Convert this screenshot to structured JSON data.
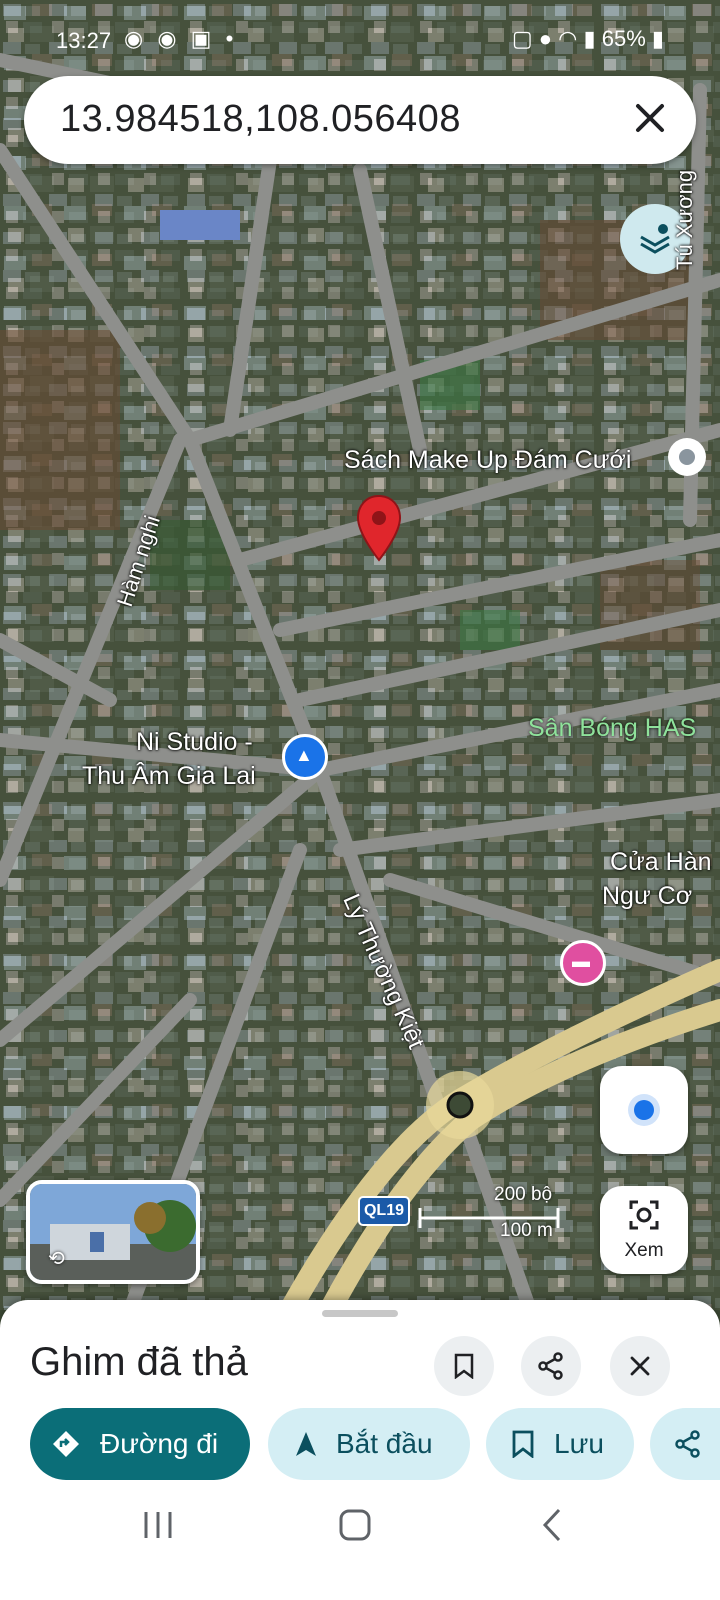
{
  "status_bar": {
    "time": "13:27",
    "notification_icons": [
      "messenger-icon",
      "messenger-icon",
      "shop-icon"
    ],
    "battery": "65%"
  },
  "search": {
    "query": "13.984518,108.056408"
  },
  "map": {
    "labels": {
      "place_1": "Sách Make Up Đám Cưới",
      "place_2_line1": "Ni Studio -",
      "place_2_line2": "Thu Âm Gia Lai",
      "place_3": "Sân Bóng HAS",
      "place_4_line1": "Cửa Hàn",
      "place_4_line2": "Ngư Cơ",
      "road_1": "Hàm nghi",
      "road_2": "Lý Thường Kiệt",
      "road_3": "Tú Xương",
      "highway": "QL19"
    },
    "scale": {
      "imperial": "200 bộ",
      "metric": "100 m"
    },
    "colors": {
      "pin": "#e0262c",
      "location_dot": "#1a73e8",
      "highway": "#d9c98f"
    }
  },
  "controls": {
    "xem_label": "Xem"
  },
  "sheet": {
    "title": "Ghim đã thả",
    "chips": {
      "directions": "Đường đi",
      "start": "Bắt đầu",
      "save": "Lưu"
    },
    "accent": "#0b6e78"
  }
}
